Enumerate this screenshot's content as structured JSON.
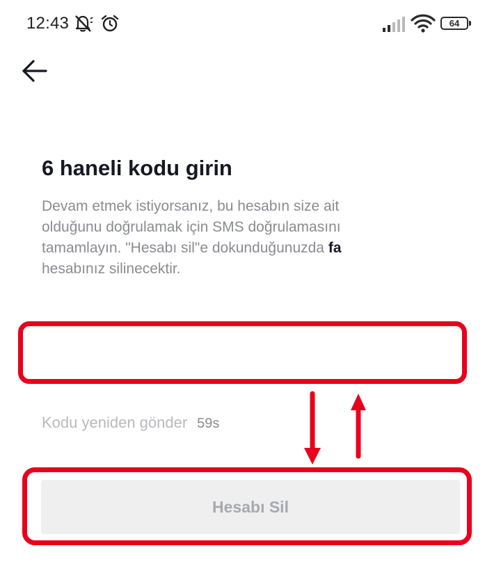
{
  "status_bar": {
    "time": "12:43",
    "battery": "64",
    "icons": [
      "mute-icon",
      "alarm-icon",
      "signal-icon",
      "wifi-icon",
      "battery-icon"
    ]
  },
  "nav": {
    "back_icon": "arrow-left-icon"
  },
  "main": {
    "title": "6 haneli kodu girin",
    "description_lines": [
      "Devam etmek istiyorsanız, bu hesabın size ait",
      "olduğunu doğrulamak için SMS doğrulamasını",
      "tamamlayın. \"Hesabı sil\"e dokunduğunuzda ",
      "hesabınız silinecektir."
    ],
    "description_bold_fragment": "fa",
    "code_input": {
      "value": "",
      "placeholder": ""
    },
    "resend_label": "Kodu yeniden gönder",
    "resend_timer": "59s",
    "delete_button_label": "Hesabı Sil"
  },
  "annotations": {
    "highlight_color": "#e8001c"
  },
  "colors": {
    "accent_red": "#e8001c",
    "button_bg": "#efeff0",
    "muted_text": "#8a8b91"
  }
}
